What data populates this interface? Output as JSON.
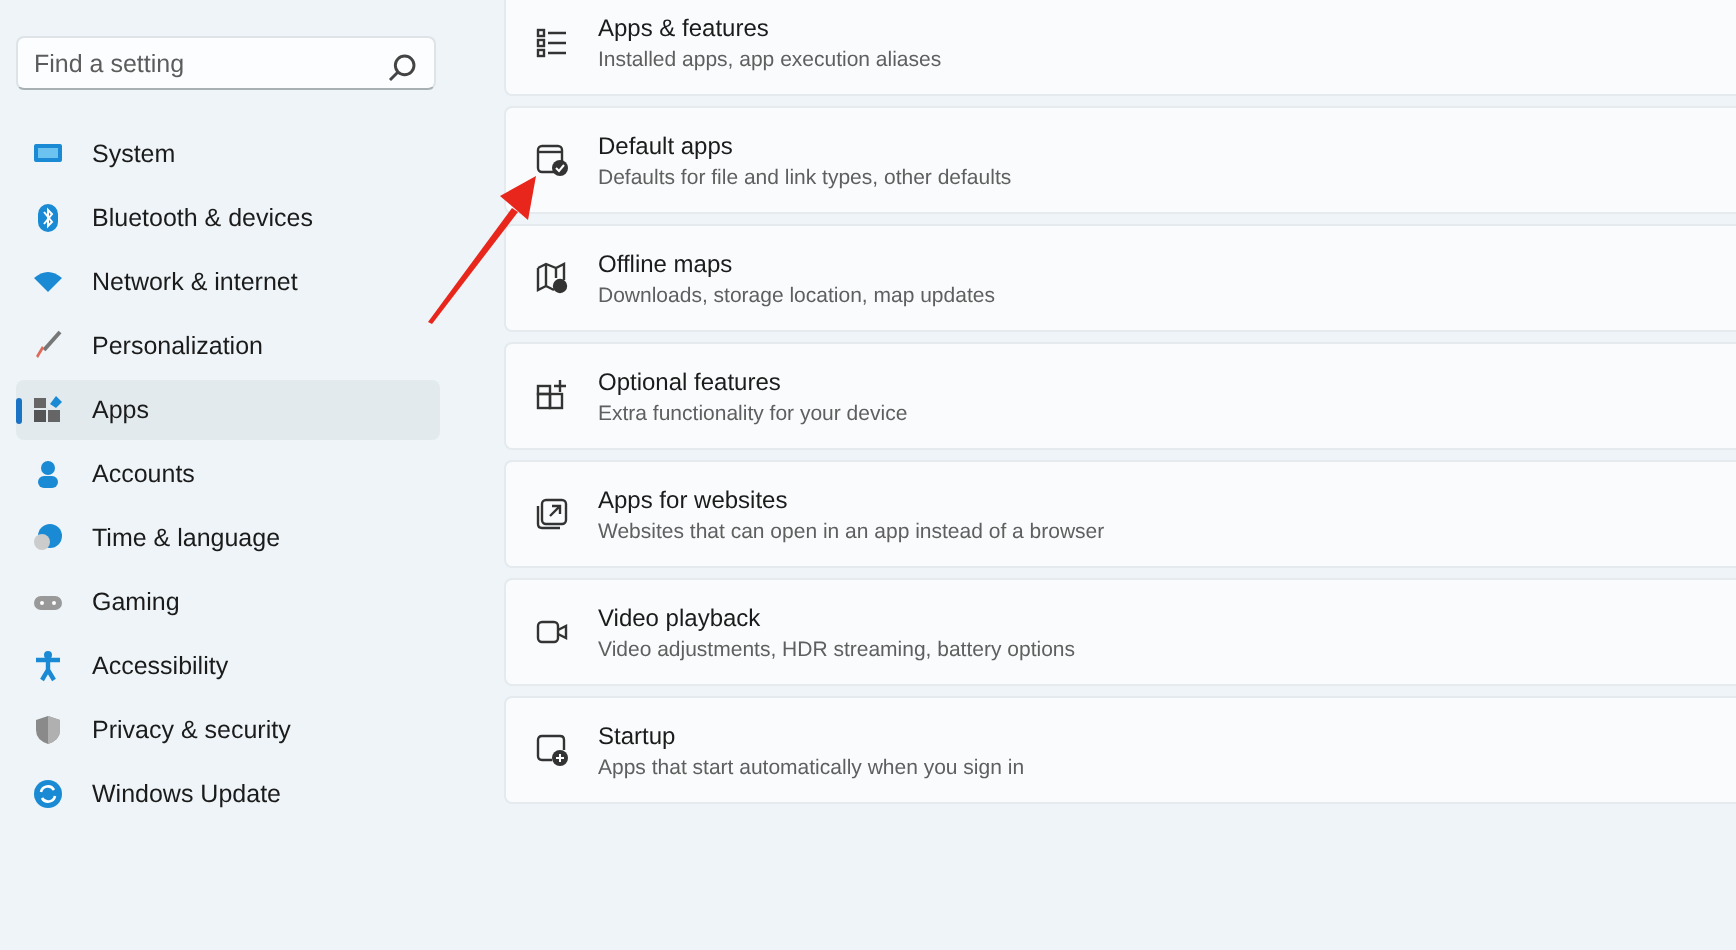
{
  "search": {
    "placeholder": "Find a setting"
  },
  "nav": [
    {
      "label": "System",
      "selected": false
    },
    {
      "label": "Bluetooth & devices",
      "selected": false
    },
    {
      "label": "Network & internet",
      "selected": false
    },
    {
      "label": "Personalization",
      "selected": false
    },
    {
      "label": "Apps",
      "selected": true
    },
    {
      "label": "Accounts",
      "selected": false
    },
    {
      "label": "Time & language",
      "selected": false
    },
    {
      "label": "Gaming",
      "selected": false
    },
    {
      "label": "Accessibility",
      "selected": false
    },
    {
      "label": "Privacy & security",
      "selected": false
    },
    {
      "label": "Windows Update",
      "selected": false
    }
  ],
  "settings": [
    {
      "title": "Apps & features",
      "description": "Installed apps, app execution aliases"
    },
    {
      "title": "Default apps",
      "description": "Defaults for file and link types, other defaults"
    },
    {
      "title": "Offline maps",
      "description": "Downloads, storage location, map updates"
    },
    {
      "title": "Optional features",
      "description": "Extra functionality for your device"
    },
    {
      "title": "Apps for websites",
      "description": "Websites that can open in an app instead of a browser"
    },
    {
      "title": "Video playback",
      "description": "Video adjustments, HDR streaming, battery options"
    },
    {
      "title": "Startup",
      "description": "Apps that start automatically when you sign in"
    }
  ]
}
